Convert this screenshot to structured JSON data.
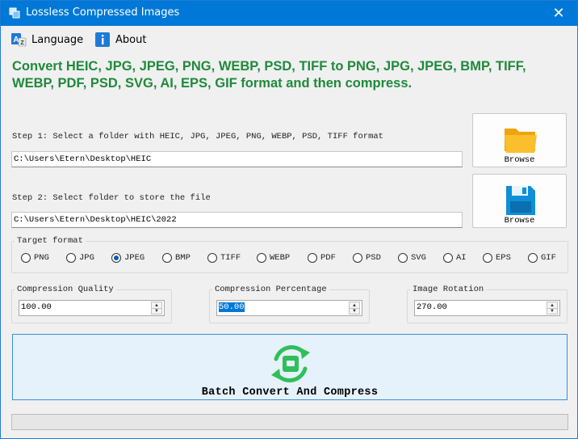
{
  "window": {
    "title": "Lossless Compressed Images",
    "close_glyph": "✕"
  },
  "menu": {
    "language_label": "Language",
    "about_label": "About",
    "language_icon": "language-icon",
    "about_icon": "info-icon"
  },
  "headline": "Convert HEIC, JPG, JPEG, PNG, WEBP, PSD, TIFF to PNG, JPG, JPEG, BMP, TIFF, WEBP, PDF, PSD, SVG, AI, EPS, GIF format and then compress.",
  "step1": {
    "label": "Step 1: Select a folder with HEIC, JPG, JPEG, PNG, WEBP, PSD, TIFF format",
    "path": "C:\\Users\\Etern\\Desktop\\HEIC",
    "browse_label": "Browse",
    "icon": "folder-icon"
  },
  "step2": {
    "label": "Step 2: Select folder to store the file",
    "path": "C:\\Users\\Etern\\Desktop\\HEIC\\2022",
    "browse_label": "Browse",
    "icon": "floppy-disk-icon"
  },
  "target_format": {
    "legend": "Target format",
    "options": [
      "PNG",
      "JPG",
      "JPEG",
      "BMP",
      "TIFF",
      "WEBP",
      "PDF",
      "PSD",
      "SVG",
      "AI",
      "EPS",
      "GIF"
    ],
    "selected": "JPEG"
  },
  "compression_quality": {
    "legend": "Compression Quality",
    "value": "100.00"
  },
  "compression_percentage": {
    "legend": "Compression Percentage",
    "value": "50.00"
  },
  "image_rotation": {
    "legend": "Image Rotation",
    "value": "270.00"
  },
  "action": {
    "label": "Batch Convert And Compress",
    "icon": "convert-cycle-icon"
  },
  "progress": {
    "value": 0
  },
  "colors": {
    "title_bar": "#0078d7",
    "headline": "#1f8a3b",
    "action_bg": "#e5f1fb",
    "action_icon": "#2fbf5a"
  }
}
